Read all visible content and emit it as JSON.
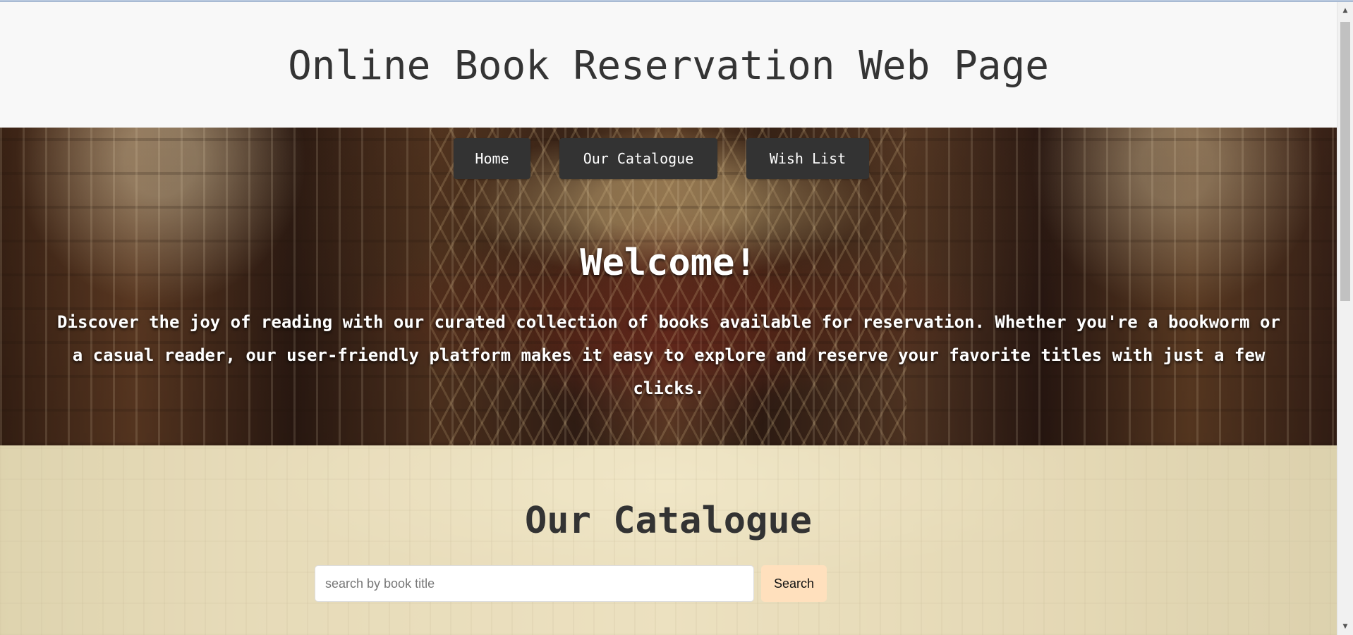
{
  "page": {
    "title": "Online Book Reservation Web Page"
  },
  "navigation": {
    "items": [
      {
        "label": "Home"
      },
      {
        "label": "Our Catalogue"
      },
      {
        "label": "Wish List"
      }
    ]
  },
  "hero": {
    "heading": "Welcome!",
    "description": "Discover the joy of reading with our curated collection of books available for reservation. Whether you're a bookworm or a casual reader, our user-friendly platform makes it easy to explore and reserve your favorite titles with just a few clicks."
  },
  "catalogue": {
    "heading": "Our Catalogue",
    "search": {
      "placeholder": "search by book title",
      "value": "",
      "button_label": "Search"
    }
  },
  "scrollbar": {
    "up_icon": "▲",
    "down_icon": "▼"
  },
  "colors": {
    "header_background": "#f8f8f8",
    "title_text": "#343434",
    "nav_button_background": "#333333",
    "hero_text": "#ffffff",
    "search_button_background": "#ffe0bd"
  }
}
